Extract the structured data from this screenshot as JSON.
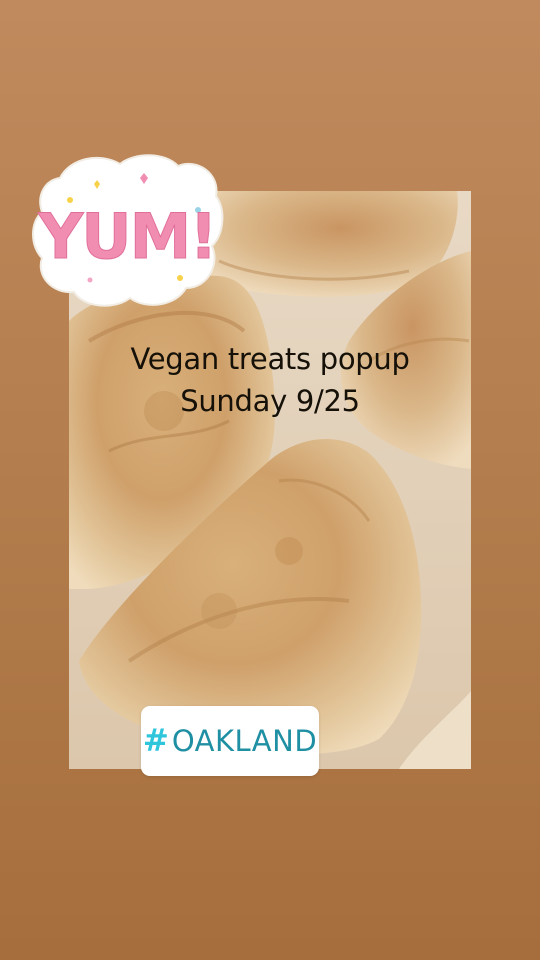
{
  "story": {
    "caption_line1": "Vegan treats popup",
    "caption_line2": "Sunday 9/25",
    "sticker_yum": "YUM!",
    "hashtag_symbol": "#",
    "hashtag_text": "OAKLAND"
  },
  "colors": {
    "background_top": "#c08a5e",
    "background_bottom": "#a66e3c",
    "hashtag_accent": "#2fc6dc",
    "hashtag_text": "#1f8fa3"
  }
}
